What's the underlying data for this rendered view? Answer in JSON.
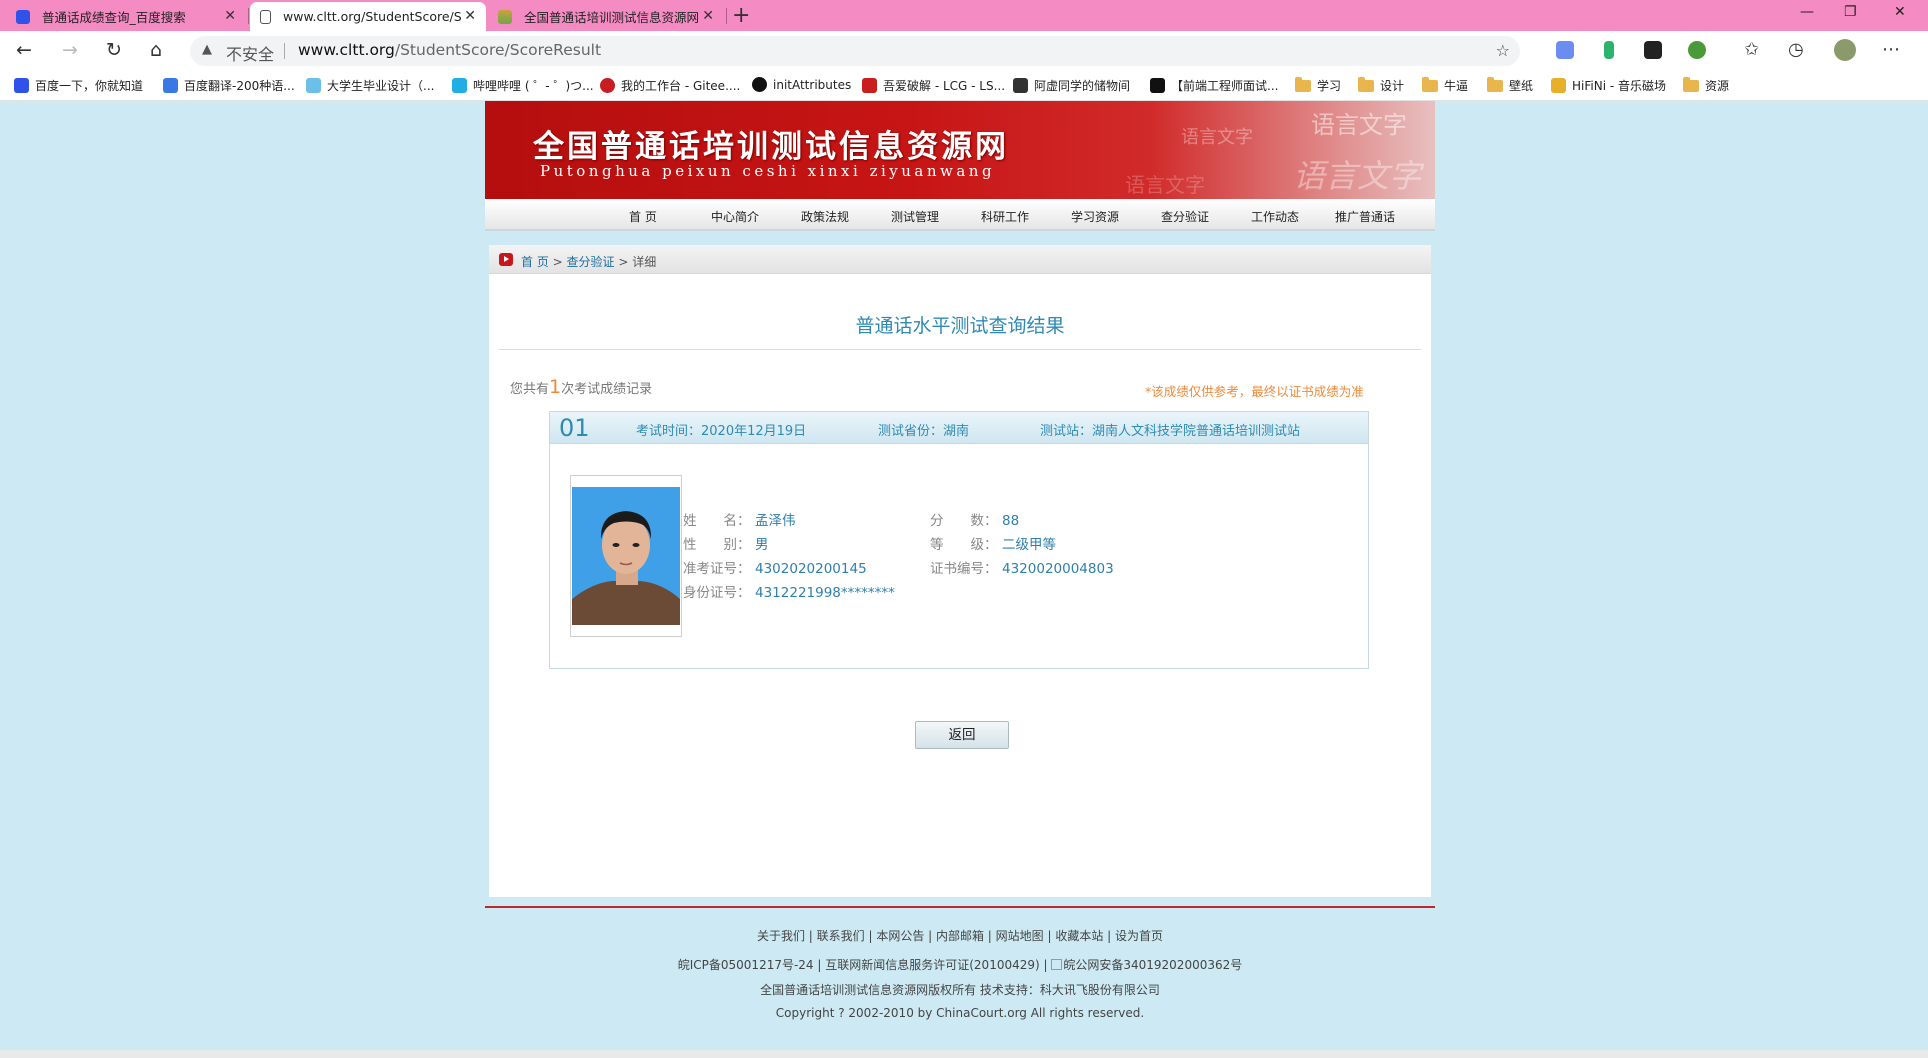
{
  "browser": {
    "tabs": [
      {
        "title": "普通话成绩查询_百度搜索"
      },
      {
        "title": "www.cltt.org/StudentScore/Score"
      },
      {
        "title": "全国普通话培训测试信息资源网"
      }
    ],
    "address": {
      "security_label": "不安全",
      "url_host": "www.cltt.org",
      "url_path": "/StudentScore/ScoreResult"
    },
    "bookmarks": [
      "百度一下，你就知道",
      "百度翻译-200种语...",
      "大学生毕业设计（...",
      "哔哩哔哩 ( ゜- ゜)つ...",
      "我的工作台 - Gitee....",
      "initAttributes",
      "吾爱破解 - LCG - LS...",
      "阿虚同学的储物间",
      "【前端工程师面试...",
      "学习",
      "设计",
      "牛逼",
      "壁纸",
      "HiFiNi - 音乐磁场",
      "资源"
    ],
    "colors": {
      "tabbar": "#f58bc3"
    }
  },
  "site": {
    "banner": {
      "title": "全国普通话培训测试信息资源网",
      "pinyin": "Putonghua peixun ceshi xinxi ziyuanwang",
      "deco1": "语言文字",
      "deco2": "语言文字",
      "deco3": "语言文字",
      "deco4": "语言文字"
    },
    "nav": [
      "首  页",
      "中心简介",
      "政策法规",
      "测试管理",
      "科研工作",
      "学习资源",
      "查分验证",
      "工作动态",
      "推广普通话"
    ],
    "breadcrumb": {
      "home": "首  页",
      "sep1": " > ",
      "section": "查分验证",
      "sep2": " > ",
      "current": "详细"
    },
    "result": {
      "title": "普通话水平测试查询结果",
      "count_prefix": "您共有",
      "count": "1",
      "count_suffix": "次考试成绩记录",
      "note": "*该成绩仅供参考，最终以证书成绩为准"
    },
    "record": {
      "no": "01",
      "exam_time": "考试时间：2020年12月19日",
      "province": "测试省份：湖南",
      "station": "测试站：湖南人文科技学院普通话培训测试站",
      "fields": {
        "name_label": "姓　　名：",
        "name": "孟泽伟",
        "gender_label": "性　　别：",
        "gender": "男",
        "ticket_label": "准考证号：",
        "ticket": "4302020200145",
        "id_label": "身份证号：",
        "id": "4312221998********",
        "score_label": "分　　数：",
        "score": "88",
        "level_label": "等　　级：",
        "level": "二级甲等",
        "cert_label": "证书编号：",
        "cert": "4320020004803"
      }
    },
    "back_label": "返回",
    "footer": {
      "links": "关于我们 | 联系我们 | 本网公告 | 内部邮箱 | 网站地图 | 收藏本站 | 设为首页",
      "icp": "皖ICP备05001217号-24 | 互联网新闻信息服务许可证(20100429) | ",
      "police": "皖公网安备34019202000362号",
      "owner": "全国普通话培训测试信息资源网版权所有  技术支持：科大讯飞股份有限公司",
      "copyright": "Copyright ? 2002-2010 by ChinaCourt.org All rights reserved."
    },
    "colors": {
      "banner_red": "#c71515",
      "accent_blue": "#2f8ab4",
      "note_orange": "#f08a3b",
      "page_bg": "#cdeaf4"
    }
  }
}
